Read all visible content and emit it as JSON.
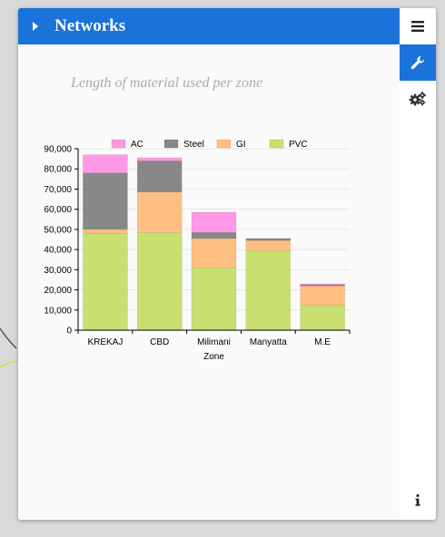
{
  "header": {
    "title": "Networks"
  },
  "content": {
    "subtitle": "Length of material used per zone"
  },
  "sidebar": {
    "buttons": [
      {
        "name": "menu-button",
        "icon": "hamburger-menu-icon"
      },
      {
        "name": "tools-button",
        "icon": "wrench-icon"
      },
      {
        "name": "settings-button",
        "icon": "gears-icon"
      },
      {
        "name": "info-button",
        "icon": "info-icon"
      }
    ]
  },
  "colors": {
    "header": "#1a73d9",
    "AC": "#ff99e6",
    "Steel": "#888888",
    "GI": "#ffbf80",
    "PVC": "#c8e070"
  },
  "chart_data": {
    "type": "bar",
    "stacked": true,
    "title": "",
    "xlabel": "Zone",
    "ylabel": "",
    "categories": [
      "KREKAJ",
      "CBD",
      "Milimani",
      "Manyatta",
      "M.E"
    ],
    "ylim": [
      0,
      90000
    ],
    "yticks": [
      0,
      10000,
      20000,
      30000,
      40000,
      50000,
      60000,
      70000,
      80000,
      90000
    ],
    "ytick_labels": [
      "0",
      "10,000",
      "20,000",
      "30,000",
      "40,000",
      "50,000",
      "60,000",
      "70,000",
      "80,000",
      "90,000"
    ],
    "legend_position": "top",
    "grid": true,
    "series": [
      {
        "name": "PVC",
        "values": [
          48000,
          48500,
          31000,
          39500,
          12500
        ]
      },
      {
        "name": "GI",
        "values": [
          2000,
          20000,
          14500,
          5000,
          9500
        ]
      },
      {
        "name": "Steel",
        "values": [
          28000,
          15500,
          3000,
          1000,
          500
        ]
      },
      {
        "name": "AC",
        "values": [
          9000,
          1500,
          10000,
          0,
          500
        ]
      }
    ],
    "legend": [
      "AC",
      "Steel",
      "GI",
      "PVC"
    ]
  }
}
